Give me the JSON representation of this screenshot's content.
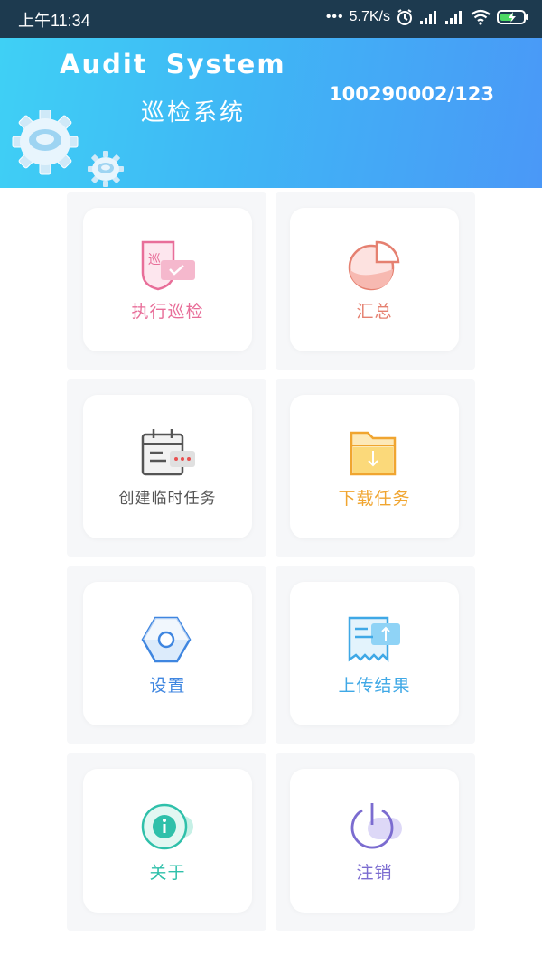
{
  "status_bar": {
    "time": "上午11:34",
    "net_speed": "5.7K/s",
    "icons": [
      "alarm-icon",
      "signal-icon",
      "signal-icon",
      "wifi-icon",
      "battery-charging-icon"
    ]
  },
  "header": {
    "title_en": "Audit System",
    "title_cn": "巡检系统",
    "device_id": "100290002/123",
    "gradient_from": "#3fd0f5",
    "gradient_to": "#4a98f7"
  },
  "menu": [
    {
      "label": "执行巡检",
      "icon": "patrol-icon",
      "color": "#e86e99"
    },
    {
      "label": "汇总",
      "icon": "pie-chart-icon",
      "color": "#e58070"
    },
    {
      "label": "创建临时任务",
      "icon": "calendar-task-icon",
      "color": "#555555"
    },
    {
      "label": "下载任务",
      "icon": "download-folder-icon",
      "color": "#f0a530"
    },
    {
      "label": "设置",
      "icon": "settings-nut-icon",
      "color": "#3f86e0"
    },
    {
      "label": "上传结果",
      "icon": "upload-receipt-icon",
      "color": "#3fa8e6"
    },
    {
      "label": "关于",
      "icon": "info-icon",
      "color": "#2fc0aa"
    },
    {
      "label": "注销",
      "icon": "power-icon",
      "color": "#7b6cd0"
    }
  ]
}
